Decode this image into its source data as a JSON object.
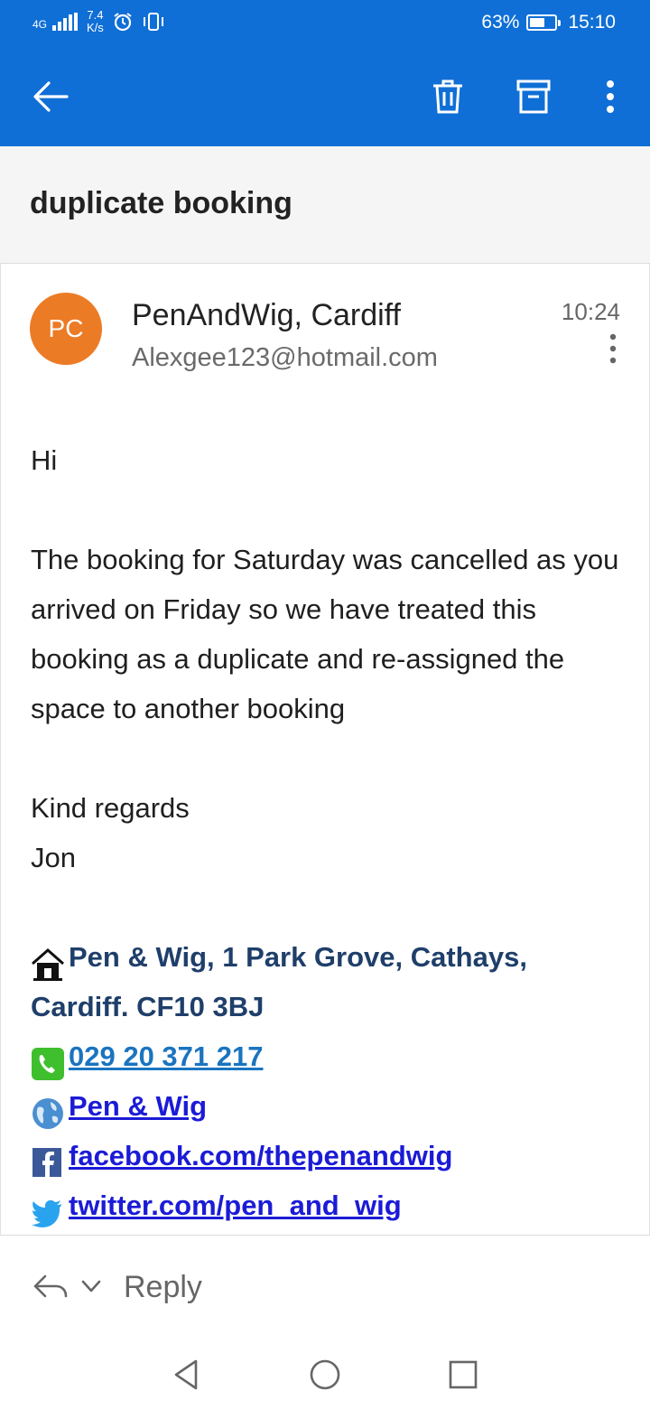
{
  "status_bar": {
    "network": "4G",
    "speed_value": "7.4",
    "speed_unit": "K/s",
    "battery_percent": "63%",
    "battery_level": 0.63,
    "clock": "15:10",
    "icons": [
      "signal-icon",
      "alarm-icon",
      "vibrate-icon",
      "battery-icon"
    ]
  },
  "app_bar": {
    "icons": [
      "back-arrow-icon",
      "trash-icon",
      "archive-icon",
      "more-vertical-icon"
    ]
  },
  "message": {
    "subject": "duplicate booking",
    "avatar_initials": "PC",
    "avatar_color": "#ec7b26",
    "sender_name": "PenAndWig, Cardiff",
    "sender_email": "Alexgee123@hotmail.com",
    "time": "10:24",
    "greeting": "Hi",
    "paragraph": "The booking for Saturday was cancelled as you arrived on Friday so we have treated this booking as a duplicate and re-assigned the space to another booking",
    "closing": "Kind regards",
    "signer": "Jon",
    "signature": {
      "address_line1": "Pen & Wig, 1 Park Grove, Cathays,",
      "address_line2": "Cardiff. CF10 3BJ",
      "phone": "029 20 371 217",
      "website": "Pen & Wig",
      "facebook": "facebook.com/thepenandwig",
      "twitter": "twitter.com/pen_and_wig"
    }
  },
  "reply_bar": {
    "label": "Reply"
  },
  "nav_bar": {
    "icons": [
      "back-triangle-icon",
      "home-circle-icon",
      "recents-square-icon"
    ]
  },
  "colors": {
    "brand_blue": "#0f6fd6",
    "address_text": "#1f3f6a",
    "phone_link": "#1a74c0",
    "link": "#1b1bd6"
  }
}
